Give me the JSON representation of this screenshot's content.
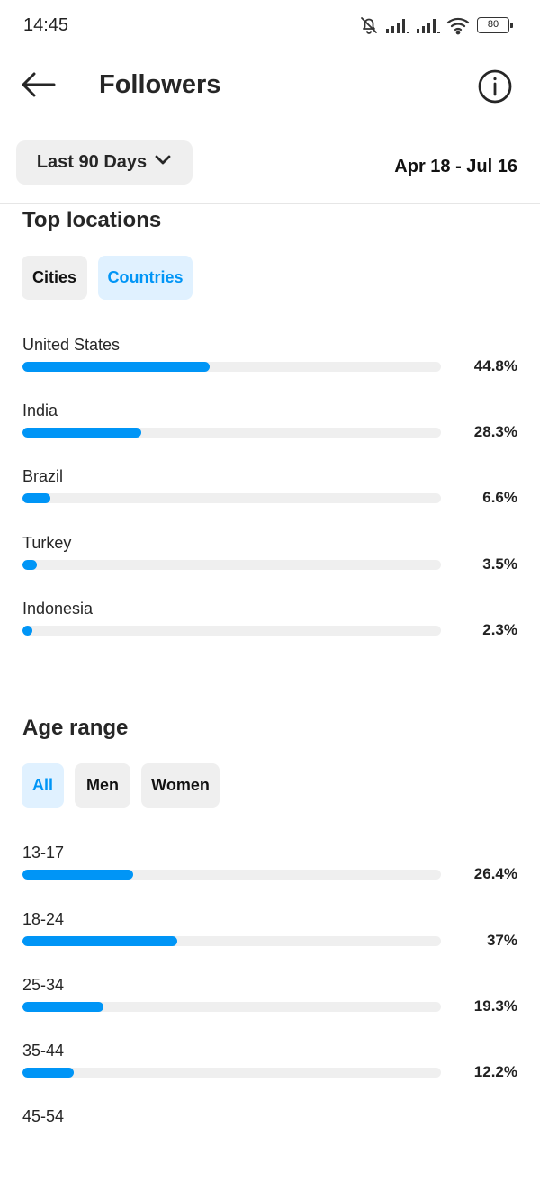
{
  "status_bar": {
    "time": "14:45",
    "icons": [
      "bell-off-icon",
      "signal-icon",
      "signal-icon",
      "wifi-icon"
    ],
    "battery": "80"
  },
  "header": {
    "back_icon": "arrow-left-icon",
    "title": "Followers",
    "info_icon": "info-icon"
  },
  "filter": {
    "range_label": "Last 90 Days",
    "range_icon": "chevron-down-icon",
    "date_range": "Apr 18 - Jul 16"
  },
  "top_locations": {
    "title": "Top locations",
    "tabs": [
      {
        "label": "Cities",
        "active": false
      },
      {
        "label": "Countries",
        "active": true
      }
    ],
    "items": [
      {
        "label": "United States",
        "value": "44.8%",
        "percent": 44.8
      },
      {
        "label": "India",
        "value": "28.3%",
        "percent": 28.3
      },
      {
        "label": "Brazil",
        "value": "6.6%",
        "percent": 6.6
      },
      {
        "label": "Turkey",
        "value": "3.5%",
        "percent": 3.5
      },
      {
        "label": "Indonesia",
        "value": "2.3%",
        "percent": 2.3
      }
    ]
  },
  "age_range": {
    "title": "Age range",
    "tabs": [
      {
        "label": "All",
        "active": true
      },
      {
        "label": "Men",
        "active": false
      },
      {
        "label": "Women",
        "active": false
      }
    ],
    "items": [
      {
        "label": "13-17",
        "value": "26.4%",
        "percent": 26.4
      },
      {
        "label": "18-24",
        "value": "37%",
        "percent": 37
      },
      {
        "label": "25-34",
        "value": "19.3%",
        "percent": 19.3
      },
      {
        "label": "35-44",
        "value": "12.2%",
        "percent": 12.2
      },
      {
        "label": "45-54",
        "value": "",
        "percent": 0
      }
    ]
  },
  "colors": {
    "accent": "#0095f6",
    "accent_bg": "#e0f1ff",
    "track": "#efefef"
  }
}
